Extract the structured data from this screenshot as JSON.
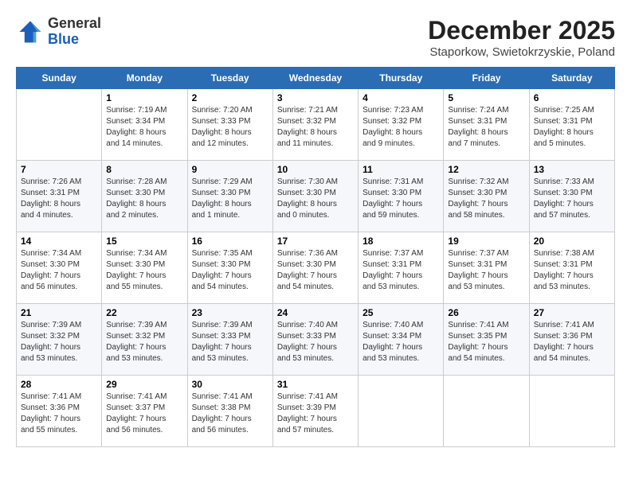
{
  "header": {
    "logo_general": "General",
    "logo_blue": "Blue",
    "main_title": "December 2025",
    "subtitle": "Staporkow, Swietokrzyskie, Poland"
  },
  "calendar": {
    "days_of_week": [
      "Sunday",
      "Monday",
      "Tuesday",
      "Wednesday",
      "Thursday",
      "Friday",
      "Saturday"
    ],
    "weeks": [
      [
        {
          "day": null,
          "info": null
        },
        {
          "day": "1",
          "info": "Sunrise: 7:19 AM\nSunset: 3:34 PM\nDaylight: 8 hours\nand 14 minutes."
        },
        {
          "day": "2",
          "info": "Sunrise: 7:20 AM\nSunset: 3:33 PM\nDaylight: 8 hours\nand 12 minutes."
        },
        {
          "day": "3",
          "info": "Sunrise: 7:21 AM\nSunset: 3:32 PM\nDaylight: 8 hours\nand 11 minutes."
        },
        {
          "day": "4",
          "info": "Sunrise: 7:23 AM\nSunset: 3:32 PM\nDaylight: 8 hours\nand 9 minutes."
        },
        {
          "day": "5",
          "info": "Sunrise: 7:24 AM\nSunset: 3:31 PM\nDaylight: 8 hours\nand 7 minutes."
        },
        {
          "day": "6",
          "info": "Sunrise: 7:25 AM\nSunset: 3:31 PM\nDaylight: 8 hours\nand 5 minutes."
        }
      ],
      [
        {
          "day": "7",
          "info": "Sunrise: 7:26 AM\nSunset: 3:31 PM\nDaylight: 8 hours\nand 4 minutes."
        },
        {
          "day": "8",
          "info": "Sunrise: 7:28 AM\nSunset: 3:30 PM\nDaylight: 8 hours\nand 2 minutes."
        },
        {
          "day": "9",
          "info": "Sunrise: 7:29 AM\nSunset: 3:30 PM\nDaylight: 8 hours\nand 1 minute."
        },
        {
          "day": "10",
          "info": "Sunrise: 7:30 AM\nSunset: 3:30 PM\nDaylight: 8 hours\nand 0 minutes."
        },
        {
          "day": "11",
          "info": "Sunrise: 7:31 AM\nSunset: 3:30 PM\nDaylight: 7 hours\nand 59 minutes."
        },
        {
          "day": "12",
          "info": "Sunrise: 7:32 AM\nSunset: 3:30 PM\nDaylight: 7 hours\nand 58 minutes."
        },
        {
          "day": "13",
          "info": "Sunrise: 7:33 AM\nSunset: 3:30 PM\nDaylight: 7 hours\nand 57 minutes."
        }
      ],
      [
        {
          "day": "14",
          "info": "Sunrise: 7:34 AM\nSunset: 3:30 PM\nDaylight: 7 hours\nand 56 minutes."
        },
        {
          "day": "15",
          "info": "Sunrise: 7:34 AM\nSunset: 3:30 PM\nDaylight: 7 hours\nand 55 minutes."
        },
        {
          "day": "16",
          "info": "Sunrise: 7:35 AM\nSunset: 3:30 PM\nDaylight: 7 hours\nand 54 minutes."
        },
        {
          "day": "17",
          "info": "Sunrise: 7:36 AM\nSunset: 3:30 PM\nDaylight: 7 hours\nand 54 minutes."
        },
        {
          "day": "18",
          "info": "Sunrise: 7:37 AM\nSunset: 3:31 PM\nDaylight: 7 hours\nand 53 minutes."
        },
        {
          "day": "19",
          "info": "Sunrise: 7:37 AM\nSunset: 3:31 PM\nDaylight: 7 hours\nand 53 minutes."
        },
        {
          "day": "20",
          "info": "Sunrise: 7:38 AM\nSunset: 3:31 PM\nDaylight: 7 hours\nand 53 minutes."
        }
      ],
      [
        {
          "day": "21",
          "info": "Sunrise: 7:39 AM\nSunset: 3:32 PM\nDaylight: 7 hours\nand 53 minutes."
        },
        {
          "day": "22",
          "info": "Sunrise: 7:39 AM\nSunset: 3:32 PM\nDaylight: 7 hours\nand 53 minutes."
        },
        {
          "day": "23",
          "info": "Sunrise: 7:39 AM\nSunset: 3:33 PM\nDaylight: 7 hours\nand 53 minutes."
        },
        {
          "day": "24",
          "info": "Sunrise: 7:40 AM\nSunset: 3:33 PM\nDaylight: 7 hours\nand 53 minutes."
        },
        {
          "day": "25",
          "info": "Sunrise: 7:40 AM\nSunset: 3:34 PM\nDaylight: 7 hours\nand 53 minutes."
        },
        {
          "day": "26",
          "info": "Sunrise: 7:41 AM\nSunset: 3:35 PM\nDaylight: 7 hours\nand 54 minutes."
        },
        {
          "day": "27",
          "info": "Sunrise: 7:41 AM\nSunset: 3:36 PM\nDaylight: 7 hours\nand 54 minutes."
        }
      ],
      [
        {
          "day": "28",
          "info": "Sunrise: 7:41 AM\nSunset: 3:36 PM\nDaylight: 7 hours\nand 55 minutes."
        },
        {
          "day": "29",
          "info": "Sunrise: 7:41 AM\nSunset: 3:37 PM\nDaylight: 7 hours\nand 56 minutes."
        },
        {
          "day": "30",
          "info": "Sunrise: 7:41 AM\nSunset: 3:38 PM\nDaylight: 7 hours\nand 56 minutes."
        },
        {
          "day": "31",
          "info": "Sunrise: 7:41 AM\nSunset: 3:39 PM\nDaylight: 7 hours\nand 57 minutes."
        },
        {
          "day": null,
          "info": null
        },
        {
          "day": null,
          "info": null
        },
        {
          "day": null,
          "info": null
        }
      ]
    ]
  }
}
